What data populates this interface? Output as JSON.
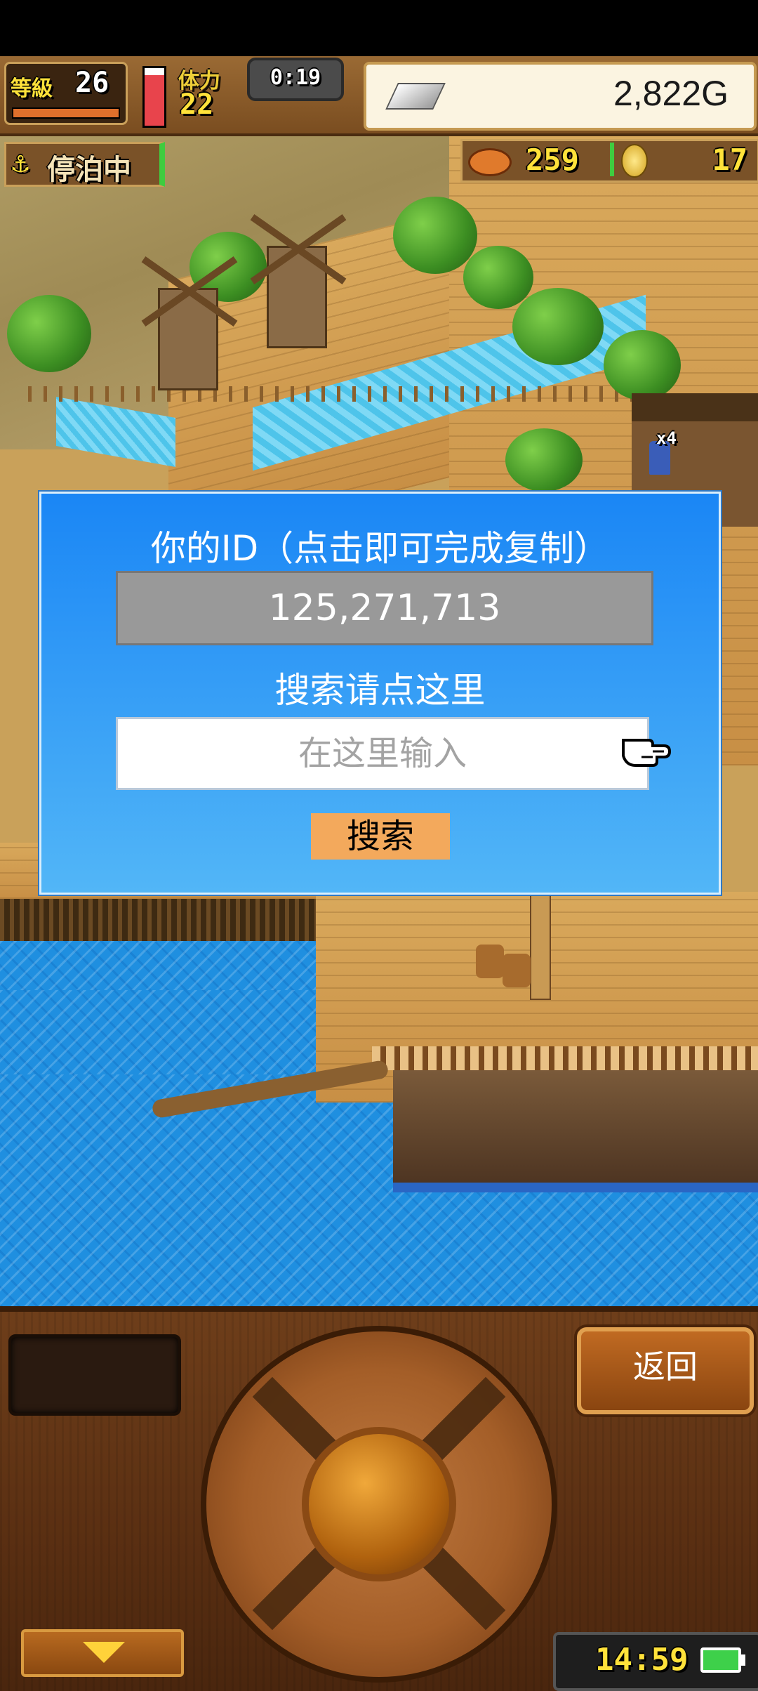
{
  "hud": {
    "level_label": "等級",
    "level": "26",
    "stamina_label": "体力",
    "stamina": "22",
    "timer": "0:19",
    "gold": "2,822G",
    "status": "停泊中",
    "food_count": "259",
    "medal_count": "17",
    "villager_badge": "x4"
  },
  "dialog": {
    "title": "你的ID（点击即可完成复制）",
    "id_value": "125,271,713",
    "search_label": "搜索请点这里",
    "search_placeholder": "在这里输入",
    "search_button": "搜索"
  },
  "panel": {
    "back_button": "返回",
    "clock": "14:59"
  },
  "colors": {
    "dialog_top": "#1a86f5",
    "dialog_bottom": "#52b6f7",
    "search_button": "#f3a95c",
    "id_box": "#999999",
    "sea": "#1f8fe0"
  },
  "icons": [
    "anchor-icon",
    "silver-bar-icon",
    "roast-meat-icon",
    "medal-icon",
    "pointing-hand-icon",
    "down-arrow-icon",
    "battery-icon",
    "ship-wheel-icon"
  ]
}
